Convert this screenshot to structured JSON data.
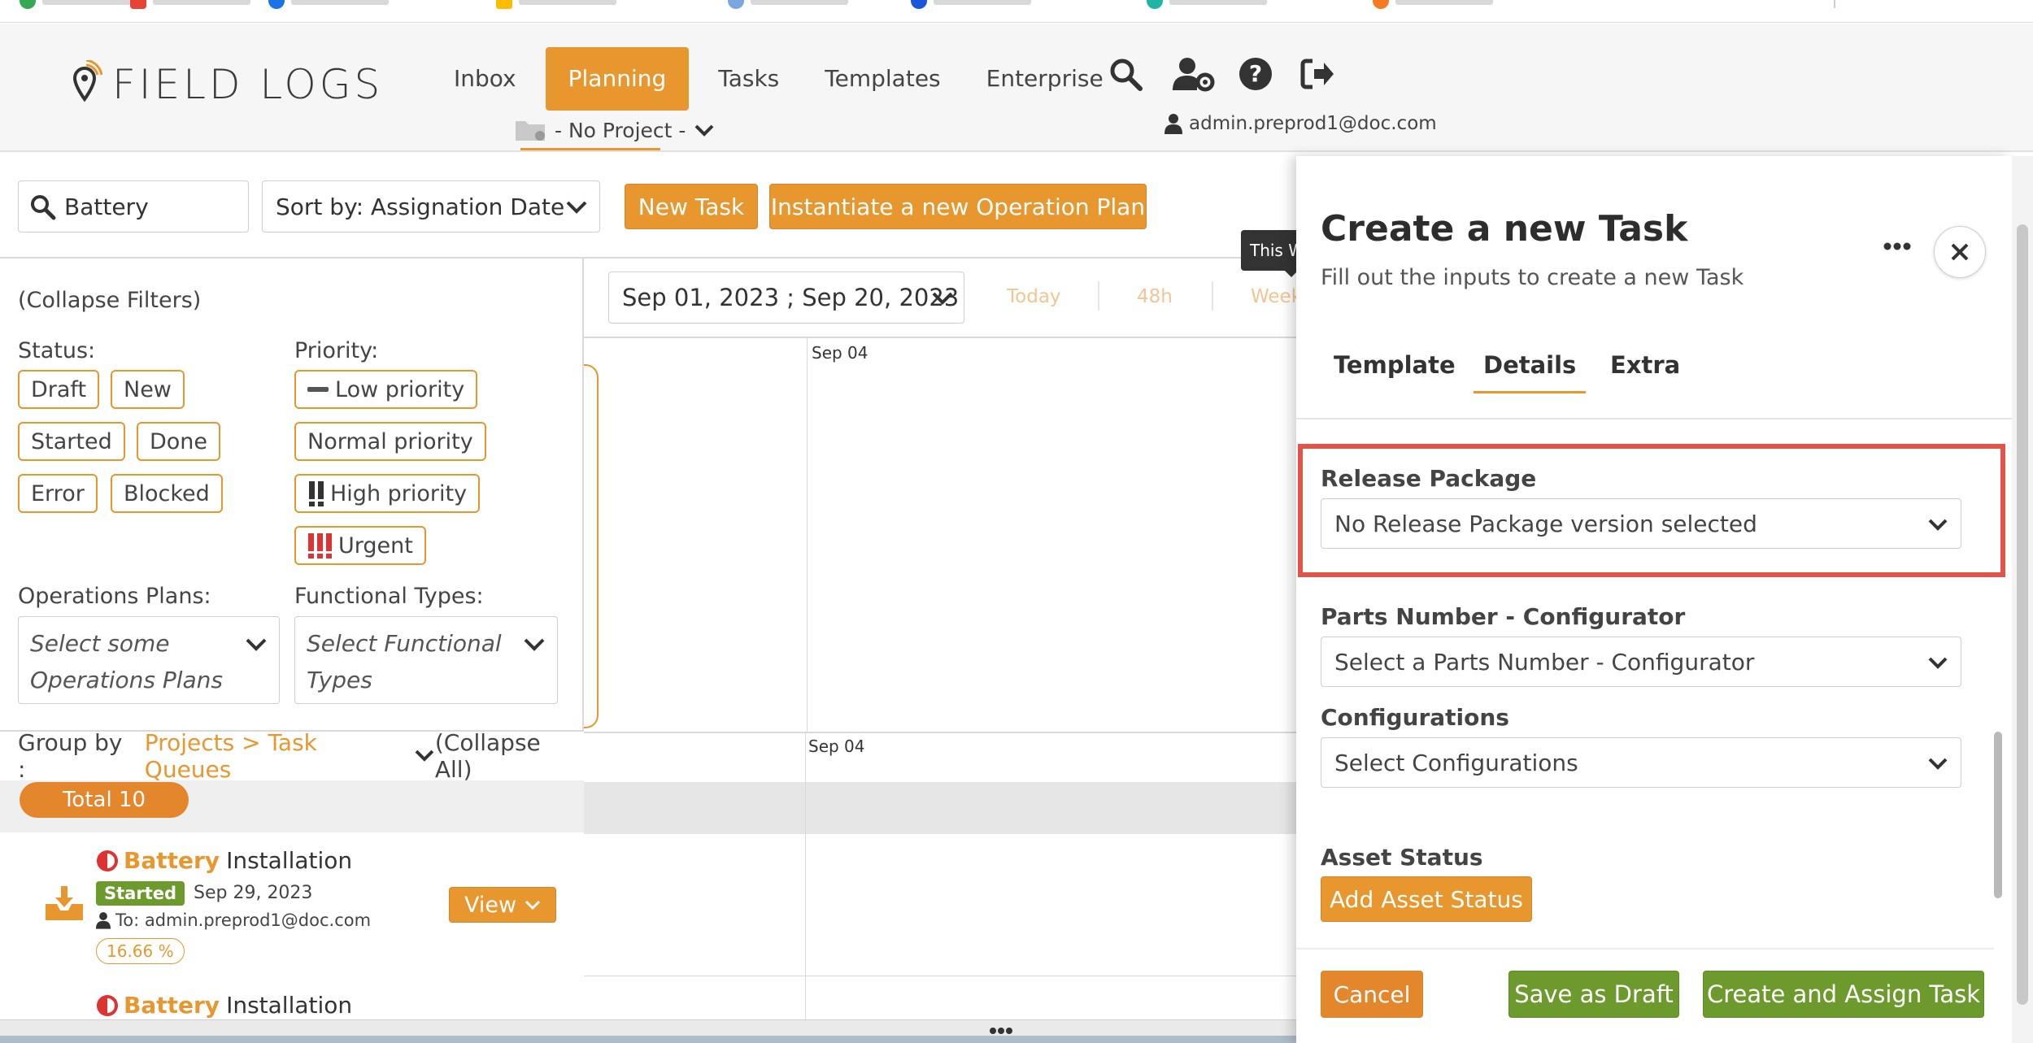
{
  "app": {
    "logo_text": "FIELD LOGS",
    "nav": [
      "Inbox",
      "Planning",
      "Tasks",
      "Templates",
      "Enterprise"
    ],
    "active_nav": "Planning",
    "project_selector": "- No Project -",
    "user_email": "admin.preprod1@doc.com"
  },
  "toolbar": {
    "search_value": "Battery",
    "sort_label": "Sort by: Assignation Date",
    "new_task_label": "New Task",
    "instantiate_label": "Instantiate a new Operation Plan"
  },
  "filters": {
    "collapse_label": "(Collapse Filters)",
    "status_label": "Status:",
    "status_options": [
      "Draft",
      "New",
      "Started",
      "Done",
      "Error",
      "Blocked"
    ],
    "priority_label": "Priority:",
    "priority_options": [
      "Low priority",
      "Normal priority",
      "High priority",
      "Urgent"
    ],
    "operations_plans_label": "Operations Plans:",
    "operations_plans_placeholder": "Select some Operations Plans",
    "functional_types_label": "Functional Types:",
    "functional_types_placeholder": "Select Functional Types"
  },
  "group": {
    "group_by_label": "Group by :",
    "group_by_value": "Projects > Task Queues",
    "collapse_all_label": "(Collapse All)",
    "total_label": "Total 10"
  },
  "tasks": [
    {
      "highlight": "Battery",
      "title_rest": "Installation",
      "status": "Started",
      "date": "Sep 29, 2023",
      "assignee": "To: admin.preprod1@doc.com",
      "progress": "16.66 %",
      "view_label": "View"
    },
    {
      "highlight": "Battery",
      "title_rest": "Installation"
    }
  ],
  "calendar": {
    "date_range": "Sep 01, 2023 ; Sep 20, 2023",
    "tabs": [
      "Today",
      "48h",
      "Week"
    ],
    "tooltip": "This Week",
    "day_label_top": "Sep 04",
    "day_label_bottom": "Sep 04"
  },
  "panel": {
    "title": "Create a new Task",
    "subtitle": "Fill out the inputs to create a new Task",
    "tabs": [
      "Template",
      "Details",
      "Extra"
    ],
    "active_tab": "Details",
    "release_package_label": "Release Package",
    "release_package_value": "No Release Package version selected",
    "parts_number_label": "Parts Number - Configurator",
    "parts_number_value": "Select a Parts Number - Configurator",
    "configurations_label": "Configurations",
    "configurations_value": "Select Configurations",
    "asset_status_label": "Asset Status",
    "add_asset_status_label": "Add Asset Status",
    "cancel_label": "Cancel",
    "save_draft_label": "Save as Draft",
    "create_assign_label": "Create and Assign Task"
  },
  "colors": {
    "accent": "#e8972e",
    "green": "#6c9a2c",
    "highlight_red": "#e0544a"
  }
}
